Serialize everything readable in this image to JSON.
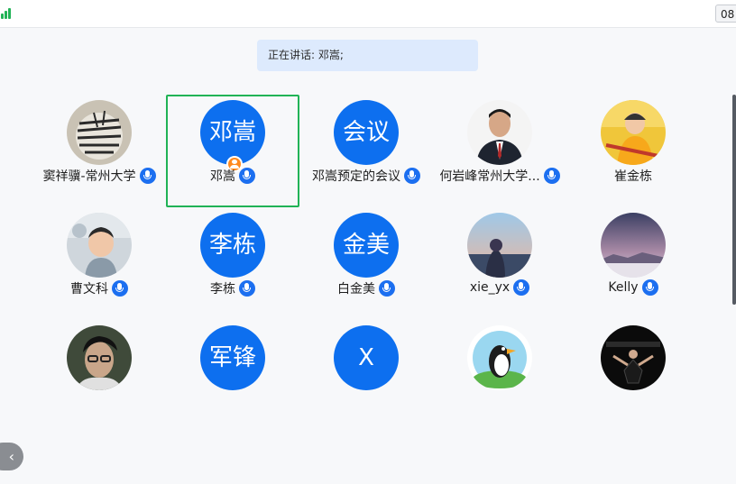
{
  "topbar": {
    "time_text": "08"
  },
  "banner": {
    "speaking_text": "正在讲话: 邓嵩;"
  },
  "participants": [
    {
      "name": "窦祥骥-常州大学",
      "avatar_text": "",
      "photo": "zebra"
    },
    {
      "name": "邓嵩",
      "avatar_text": "邓嵩",
      "host": true,
      "active": true
    },
    {
      "name": "邓嵩预定的会议",
      "avatar_text": "会议"
    },
    {
      "name": "何岩峰常州大学...",
      "avatar_text": "",
      "photo": "man-suit"
    },
    {
      "name": "崔金栋",
      "avatar_text": "",
      "photo": "child-yellow"
    },
    {
      "name": "曹文科",
      "avatar_text": "",
      "photo": "toddler"
    },
    {
      "name": "李栋",
      "avatar_text": "李栋"
    },
    {
      "name": "白金美",
      "avatar_text": "金美"
    },
    {
      "name": "xie_yx",
      "avatar_text": "",
      "photo": "anime-sky"
    },
    {
      "name": "Kelly",
      "avatar_text": "",
      "photo": "dusk-landscape"
    },
    {
      "name": "",
      "avatar_text": "",
      "photo": "man-glasses"
    },
    {
      "name": "",
      "avatar_text": "军锋"
    },
    {
      "name": "",
      "avatar_text": "X"
    },
    {
      "name": "",
      "avatar_text": "",
      "photo": "penguin"
    },
    {
      "name": "",
      "avatar_text": "",
      "photo": "stage-person"
    }
  ],
  "nav": {
    "prev_label": "‹"
  },
  "colors": {
    "accent_blue": "#0d6fef",
    "active_border": "#21b356",
    "banner_bg": "#ddeafd"
  }
}
